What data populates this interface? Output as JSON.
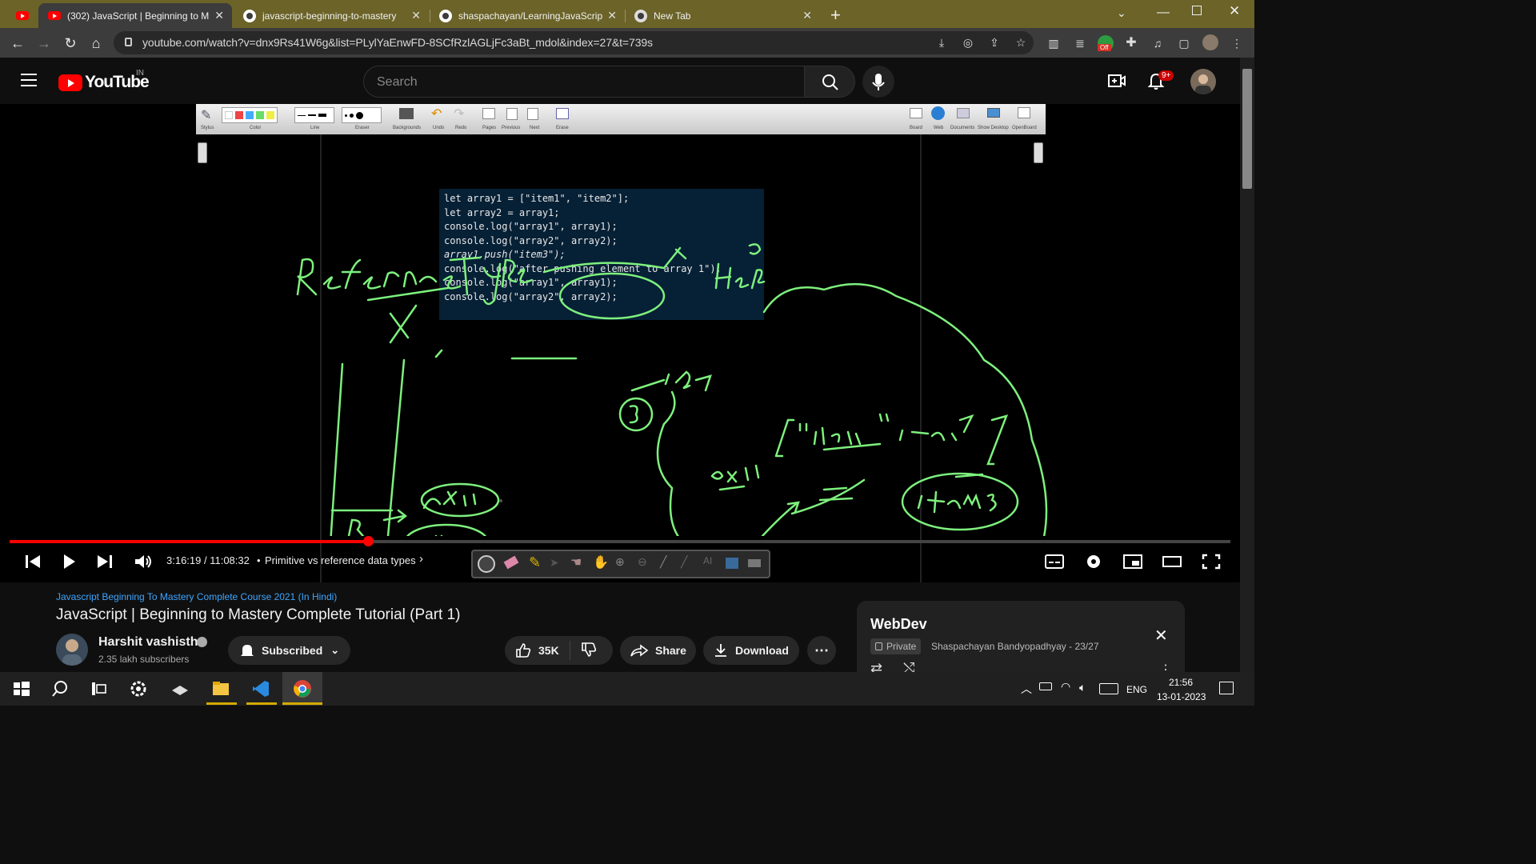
{
  "browser": {
    "tabs": [
      {
        "title": ""
      },
      {
        "title": "(302) JavaScript | Beginning to M"
      },
      {
        "title": "javascript-beginning-to-mastery"
      },
      {
        "title": "shaspachayan/LearningJavaScrip"
      },
      {
        "title": "New Tab"
      }
    ],
    "url": "youtube.com/watch?v=dnx9Rs41W6g&list=PLylYaEnwFD-8SCfRzlAGLjFc3aBt_mdol&index=27&t=739s",
    "extension_badge": "Off"
  },
  "youtube": {
    "logo_text": "YouTube",
    "country_code": "IN",
    "search_placeholder": "Search",
    "notification_count": "9+"
  },
  "whiteboard": {
    "toolbar_labels": [
      "Stylus",
      "Color",
      "Line",
      "Eraser",
      "Backgrounds",
      "Undo",
      "Redo",
      "Pages",
      "Previous",
      "Next",
      "Erase"
    ],
    "right_labels": [
      "Board",
      "Web",
      "Documents",
      "Show Desktop",
      "OpenBoard"
    ],
    "code_lines": [
      "let array1 = [\"item1\", \"item2\"];",
      "let array2 = array1;",
      "console.log(\"array1\", array1);",
      "console.log(\"array2\", array2);",
      "array1.push(\"item3\");",
      "console.log(\"after pushing element to array 1\");",
      "console.log(\"array1\", array1);",
      "console.log(\"array2\", array2);"
    ],
    "ink_color": "#7df07d"
  },
  "player": {
    "time": "3:16:19 / 11:08:32",
    "chapter": "Primitive vs reference data types",
    "progress": 0.2935
  },
  "video": {
    "playlist_link": "Javascript Beginning To Mastery Complete Course 2021 (In Hindi)",
    "title": "JavaScript | Beginning to Mastery Complete Tutorial (Part 1)",
    "channel_name": "Harshit vashisth",
    "subscribers": "2.35 lakh subscribers",
    "subscribe_label": "Subscribed",
    "likes": "35K",
    "share_label": "Share",
    "download_label": "Download"
  },
  "playlist_panel": {
    "title": "WebDev",
    "privacy": "Private",
    "meta": "Shaspachayan Bandyopadhyay - 23/27"
  },
  "taskbar": {
    "lang": "ENG",
    "time": "21:56",
    "date": "13-01-2023"
  }
}
